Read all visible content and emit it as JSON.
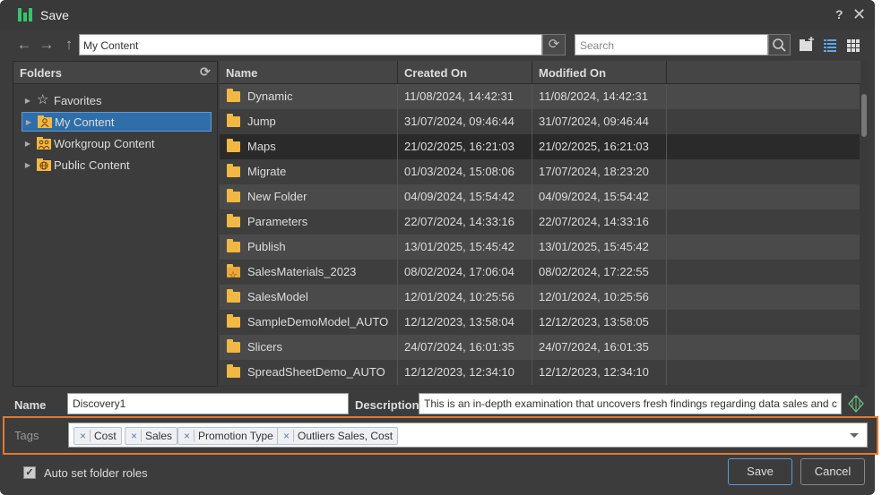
{
  "window": {
    "title": "Save",
    "help": "?",
    "close": "✕"
  },
  "toolbar": {
    "path": "My Content",
    "search_placeholder": "Search"
  },
  "folders": {
    "header": "Folders",
    "items": [
      {
        "label": "Favorites",
        "icon": "star-icon",
        "selected": false
      },
      {
        "label": "My Content",
        "icon": "user-folder-icon",
        "selected": true
      },
      {
        "label": "Workgroup Content",
        "icon": "group-folder-icon",
        "selected": false
      },
      {
        "label": "Public Content",
        "icon": "globe-folder-icon",
        "selected": false
      }
    ]
  },
  "files": {
    "columns": [
      "Name",
      "Created On",
      "Modified On"
    ],
    "rows": [
      {
        "name": "Dynamic",
        "created": "11/08/2024, 14:42:31",
        "modified": "11/08/2024, 14:42:31",
        "icon": "folder"
      },
      {
        "name": "Jump",
        "created": "31/07/2024, 09:46:44",
        "modified": "31/07/2024, 09:46:44",
        "icon": "folder"
      },
      {
        "name": "Maps",
        "created": "21/02/2025, 16:21:03",
        "modified": "21/02/2025, 16:21:03",
        "icon": "folder",
        "selected": true
      },
      {
        "name": "Migrate",
        "created": "01/03/2024, 15:08:06",
        "modified": "17/07/2024, 18:23:20",
        "icon": "folder"
      },
      {
        "name": "New Folder",
        "created": "04/09/2024, 15:54:42",
        "modified": "04/09/2024, 15:54:42",
        "icon": "folder"
      },
      {
        "name": "Parameters",
        "created": "22/07/2024, 14:33:16",
        "modified": "22/07/2024, 14:33:16",
        "icon": "folder"
      },
      {
        "name": "Publish",
        "created": "13/01/2025, 15:45:42",
        "modified": "13/01/2025, 15:45:42",
        "icon": "folder"
      },
      {
        "name": "SalesMaterials_2023",
        "created": "08/02/2024, 17:06:04",
        "modified": "08/02/2024, 17:22:55",
        "icon": "star-folder"
      },
      {
        "name": "SalesModel",
        "created": "12/01/2024, 10:25:56",
        "modified": "12/01/2024, 10:25:56",
        "icon": "folder"
      },
      {
        "name": "SampleDemoModel_AUTO",
        "created": "12/12/2023, 13:58:04",
        "modified": "12/12/2023, 13:58:05",
        "icon": "folder"
      },
      {
        "name": "Slicers",
        "created": "24/07/2024, 16:01:35",
        "modified": "24/07/2024, 16:01:35",
        "icon": "folder"
      },
      {
        "name": "SpreadSheetDemo_AUTO",
        "created": "12/12/2023, 12:34:10",
        "modified": "12/12/2023, 12:34:10",
        "icon": "folder"
      }
    ]
  },
  "form": {
    "name_label": "Name",
    "name_value": "Discovery1",
    "description_label": "Description",
    "description_value": "This is an in-depth examination that uncovers fresh findings regarding data sales and c",
    "tags_label": "Tags",
    "tags": [
      {
        "remove": "×",
        "label": "Cost"
      },
      {
        "remove": "×",
        "label": "Sales"
      },
      {
        "remove": "×",
        "label": "Promotion Type"
      },
      {
        "remove": "×",
        "label": "Outliers Sales, Cost"
      }
    ],
    "auto_roles_label": "Auto set folder roles",
    "auto_roles_checked": "✓"
  },
  "buttons": {
    "save": "Save",
    "cancel": "Cancel"
  },
  "colors": {
    "accent": "#2f6ea8",
    "highlight": "#e07a2e",
    "brand": "#35c46b",
    "folder": "#f1b843"
  }
}
